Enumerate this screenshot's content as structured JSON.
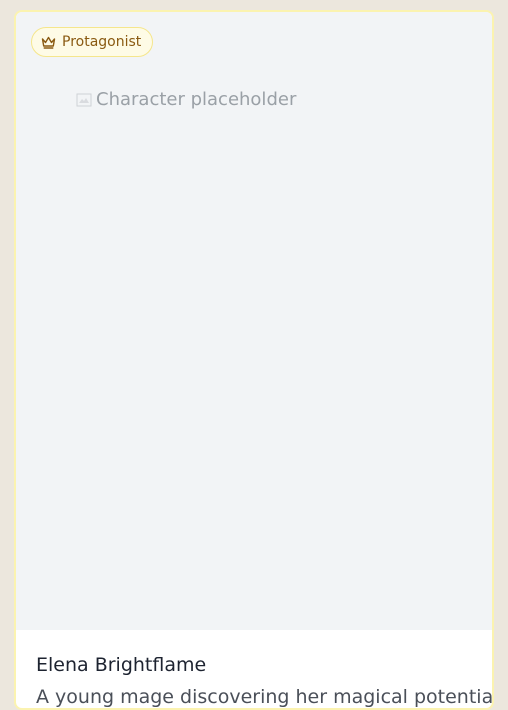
{
  "badge": {
    "label": "Protagonist",
    "icon": "crown-icon"
  },
  "image": {
    "alt": "Character placeholder"
  },
  "character": {
    "name": "Elena Brightflame",
    "description": "A young mage discovering her magical potential and"
  },
  "colors": {
    "card_border": "#fbf3b0",
    "badge_bg": "#fefbe6",
    "badge_border": "#f5e68c",
    "badge_text": "#8a5a12",
    "page_bg": "#ece7dd",
    "image_bg": "#f2f4f6"
  }
}
